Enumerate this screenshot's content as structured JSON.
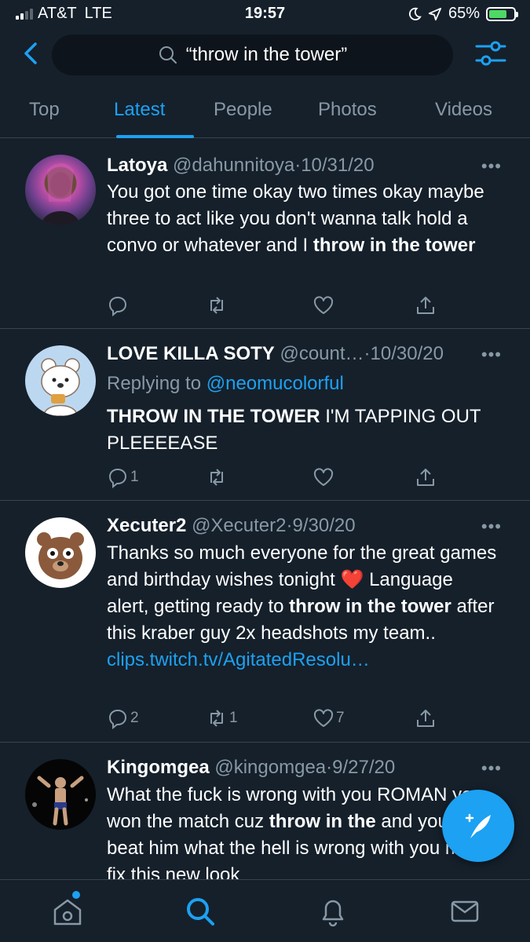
{
  "status_bar": {
    "carrier": "AT&T",
    "network": "LTE",
    "time": "19:57",
    "battery": "65%",
    "battery_level": 0.65,
    "signal_bars": 2
  },
  "search": {
    "query": "“throw in the tower”"
  },
  "tabs": [
    {
      "label": "Top",
      "active": false
    },
    {
      "label": "Latest",
      "active": true
    },
    {
      "label": "People",
      "active": false
    },
    {
      "label": "Photos",
      "active": false
    },
    {
      "label": "Videos",
      "active": false
    }
  ],
  "tweets": [
    {
      "name": "Latoya",
      "handle": "@dahunnitoya",
      "sep": "·",
      "date": "10/31/20",
      "text_1": "You got one time okay two times okay maybe three to act like you don't wanna talk hold a convo or whatever and I ",
      "highlight_1": "throw in the tower",
      "replies": "",
      "retweets": "",
      "likes": ""
    },
    {
      "name": "LOVE KILLA SOTY",
      "handle": "@count…",
      "sep": "·",
      "date": "10/30/20",
      "replying_label": "Replying to ",
      "replying_handle": "@neomucolorful",
      "highlight_1": "THROW IN THE TOWER",
      "text_1": " I'M TAPPING OUT PLEEEEASE",
      "replies": "1",
      "retweets": "",
      "likes": ""
    },
    {
      "name": "Xecuter2",
      "handle": "@Xecuter2",
      "sep": "·",
      "date": "9/30/20",
      "text_1": "Thanks so much everyone for the great games and birthday wishes tonight ",
      "emoji": "❤️",
      "text_2": " Language alert, getting ready to ",
      "highlight_1": "throw in the tower",
      "text_3": " after this kraber guy 2x headshots my team.. ",
      "link": "clips.twitch.tv/AgitatedResolu…",
      "replies": "2",
      "retweets": "1",
      "likes": "7"
    },
    {
      "name": "Kingomgea",
      "handle": "@kingomgea",
      "sep": "·",
      "date": "9/27/20",
      "text_1": "What the fuck is wrong with you ROMAN you won the match cuz ",
      "highlight_1": "throw in the",
      "text_2": " and you keep beat him what the hell is wrong with you man fix this new look"
    }
  ],
  "more_label": "•••",
  "colors": {
    "background": "#15202b",
    "accent": "#1da1f2",
    "muted": "#8899a6",
    "divider": "#38444d"
  },
  "icons": {
    "back": "chevron-left-icon",
    "search": "search-icon",
    "filter": "sliders-icon",
    "compose": "feather-icon",
    "nav": [
      "home-icon",
      "search-icon",
      "bell-icon",
      "mail-icon"
    ]
  }
}
